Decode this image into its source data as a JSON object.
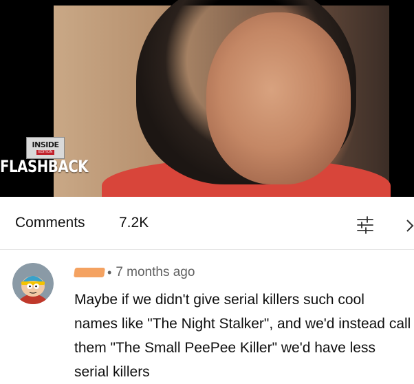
{
  "video": {
    "badge_top": "INSIDE",
    "badge_sub": "EDITION",
    "title_overlay": "FLASHBACK"
  },
  "comments": {
    "title": "Comments",
    "count": "7.2K",
    "icons": {
      "sort": "sort-filter-icon",
      "expand": "chevron-right-icon"
    }
  },
  "comment": {
    "time": "7 months ago",
    "separator": "•",
    "text": "Maybe if we didn't give serial killers such cool names like \"The Night Stalker\", and we'd instead call them \"The Small PeePee Killer\" we'd have less serial killers"
  },
  "colors": {
    "text_primary": "#0f0f0f",
    "text_secondary": "#606060",
    "redaction": "#f4a261",
    "shirt": "#d8453a"
  }
}
